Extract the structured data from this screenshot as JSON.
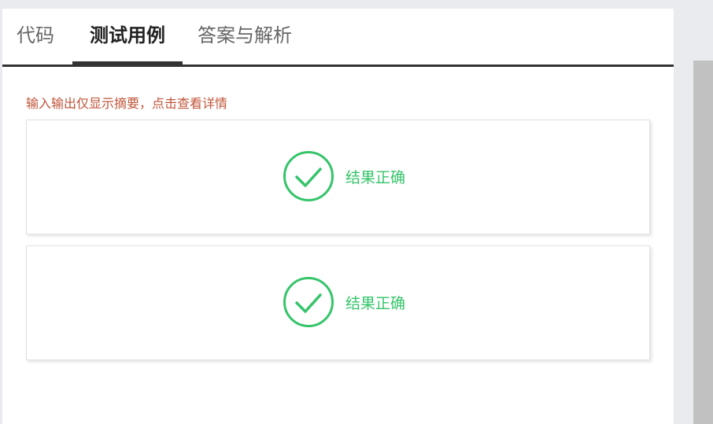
{
  "tabs": [
    {
      "label": "代码"
    },
    {
      "label": "测试用例"
    },
    {
      "label": "答案与解析"
    }
  ],
  "hint": "输入输出仅显示摘要，点击查看详情",
  "cases": [
    {
      "status": "结果正确"
    },
    {
      "status": "结果正确"
    }
  ],
  "colors": {
    "success": "#35c46a",
    "hint": "#c0553a",
    "tab_active": "#222222",
    "tab_inactive": "#666666"
  },
  "icons": {
    "case_status": "check-circle-icon"
  }
}
